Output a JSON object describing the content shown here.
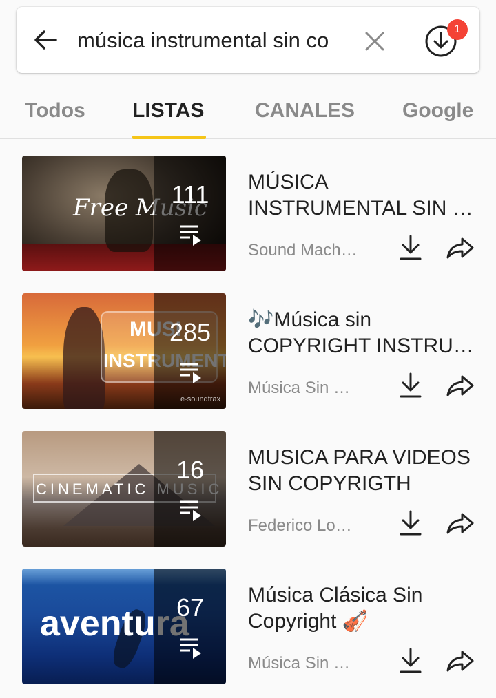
{
  "search": {
    "query": "música instrumental sin co",
    "download_badge": "1"
  },
  "tabs": [
    {
      "label": "Todos"
    },
    {
      "label": "LISTAS"
    },
    {
      "label": "CANALES"
    },
    {
      "label": "Google"
    }
  ],
  "playlists": [
    {
      "count": "111",
      "title_line1": "MÚSICA",
      "title_line2": "INSTRUMENTAL SIN …",
      "channel": "Sound Machi…",
      "thumb_text": "Free Music"
    },
    {
      "count": "285",
      "title_line1": "🎶Música sin",
      "title_line2": "COPYRIGHT INSTRU…",
      "channel": "Música Sin C…",
      "thumb_text_1": "MUSI",
      "thumb_text_2": "INSTRUMENTAL",
      "thumb_watermark": "e-soundtrax"
    },
    {
      "count": "16",
      "title_line1": "MUSICA PARA VIDEOS",
      "title_line2": "SIN COPYRIGTH",
      "channel": "Federico Lopez",
      "thumb_text": "CINEMATIC MUSIC"
    },
    {
      "count": "67",
      "title_line1": "Música Clásica Sin",
      "title_line2": "Copyright 🎻",
      "channel": "Música Sin C…",
      "thumb_text": "aventura"
    }
  ],
  "colors": {
    "accent": "#f5c518",
    "badge": "#f44336"
  }
}
